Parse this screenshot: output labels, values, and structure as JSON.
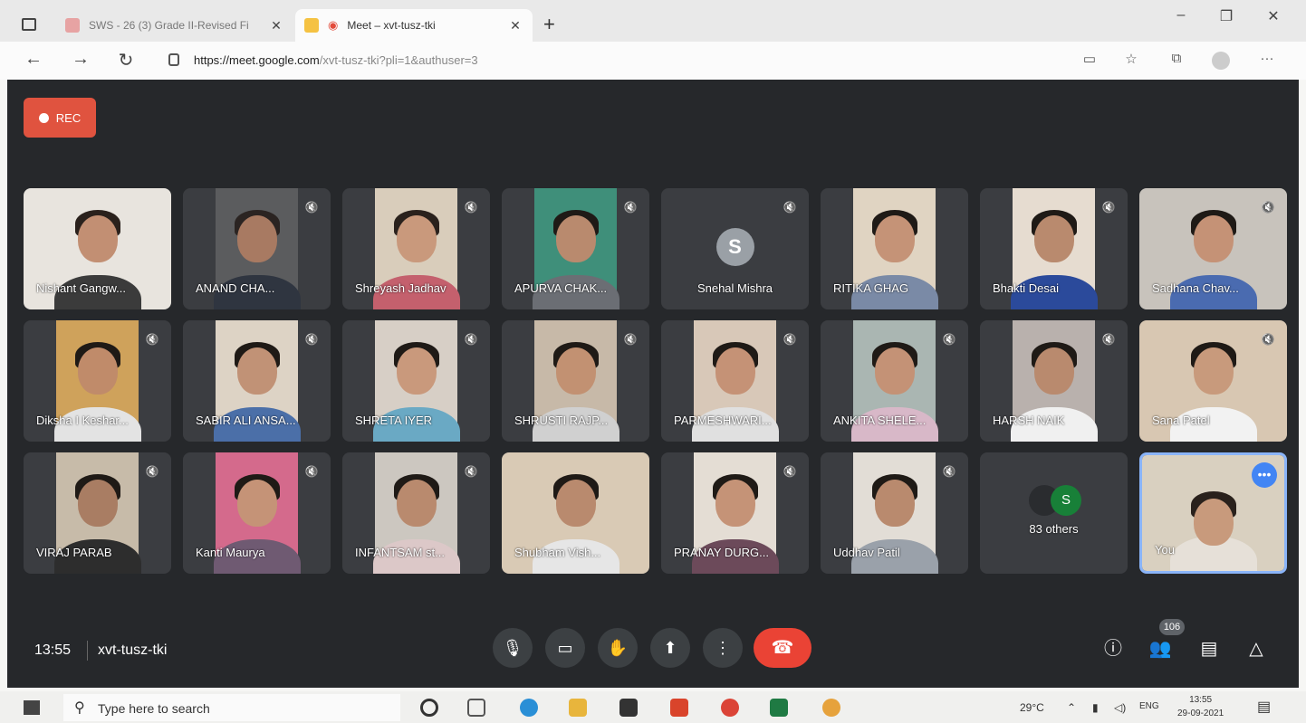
{
  "browser": {
    "tabs": [
      {
        "title": "SWS - 26 (3) Grade II-Revised Fi",
        "active": false
      },
      {
        "title": "Meet – xvt-tusz-tki",
        "active": true
      }
    ],
    "url_host": "https://meet.google.com",
    "url_path": "/xvt-tusz-tki?pli=1&authuser=3"
  },
  "meet": {
    "rec_label": "REC",
    "time": "13:55",
    "meeting_code": "xvt-tusz-tki",
    "participant_count": "106",
    "participants": [
      {
        "name": "Nishant Gangw...",
        "mic_off": false
      },
      {
        "name": "ANAND CHA...",
        "mic_off": true
      },
      {
        "name": "Shreyash Jadhav",
        "mic_off": true
      },
      {
        "name": "APURVA CHAK...",
        "mic_off": true
      },
      {
        "name": "Snehal Mishra",
        "mic_off": true,
        "avatar_letter": "S"
      },
      {
        "name": "RITIKA GHAG",
        "mic_off": false
      },
      {
        "name": "Bhakti Desai",
        "mic_off": true
      },
      {
        "name": "Sadhana Chav...",
        "mic_off": true
      },
      {
        "name": "Diksha I Keshar...",
        "mic_off": true
      },
      {
        "name": "SABIR ALI ANSA...",
        "mic_off": true
      },
      {
        "name": "SHRETA IYER",
        "mic_off": true
      },
      {
        "name": "SHRUSTI RAJP...",
        "mic_off": true
      },
      {
        "name": "PARMESHWARI...",
        "mic_off": true
      },
      {
        "name": "ANKITA SHELE...",
        "mic_off": true
      },
      {
        "name": "HARSH NAIK",
        "mic_off": true
      },
      {
        "name": "Sana Patel",
        "mic_off": true
      },
      {
        "name": "VIRAJ PARAB",
        "mic_off": true
      },
      {
        "name": "Kanti Maurya",
        "mic_off": true
      },
      {
        "name": "INFANTSAM st...",
        "mic_off": true
      },
      {
        "name": "Shubham Vish...",
        "mic_off": false
      },
      {
        "name": "PRANAY DURG...",
        "mic_off": true
      },
      {
        "name": "Uddhav Patil",
        "mic_off": true
      }
    ],
    "others_label": "83 others",
    "others_avatar_letter": "S",
    "you_label": "You"
  },
  "taskbar": {
    "search_placeholder": "Type here to search",
    "temperature": "29°C",
    "language": "ENG",
    "clock_time": "13:55",
    "clock_date": "29-09-2021"
  },
  "colors": {
    "stage_bg": "#26282b",
    "tile_bg": "#3b3d41",
    "rec_red": "#e0533f",
    "hangup_red": "#ea4335",
    "you_border": "#8ab4f8"
  }
}
